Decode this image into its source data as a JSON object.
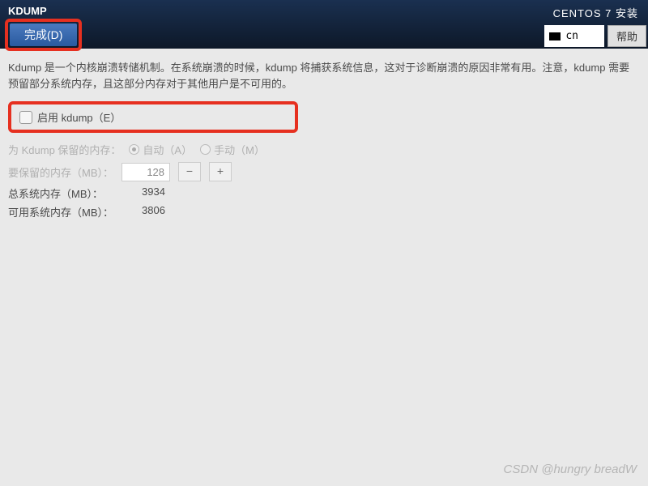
{
  "header": {
    "title": "KDUMP",
    "done_button": "完成(D)",
    "right_title": "CENTOS 7 安装",
    "lang": "cn",
    "help": "帮助"
  },
  "content": {
    "description": "Kdump 是一个内核崩溃转储机制。在系统崩溃的时候，kdump 将捕获系统信息，这对于诊断崩溃的原因非常有用。注意，kdump 需要预留部分系统内存，且这部分内存对于其他用户是不可用的。",
    "enable_checkbox": "启用 kdump（E）",
    "reserved_label": "为 Kdump 保留的内存：",
    "auto_label": "自动（A）",
    "manual_label": "手动（M）",
    "memory_label": "要保留的内存（MB）：",
    "memory_value": "128",
    "total_mem_label": "总系统内存（MB）：",
    "total_mem_value": "3934",
    "avail_mem_label": "可用系统内存（MB）：",
    "avail_mem_value": "3806"
  },
  "watermark": "CSDN @hungry breadW"
}
